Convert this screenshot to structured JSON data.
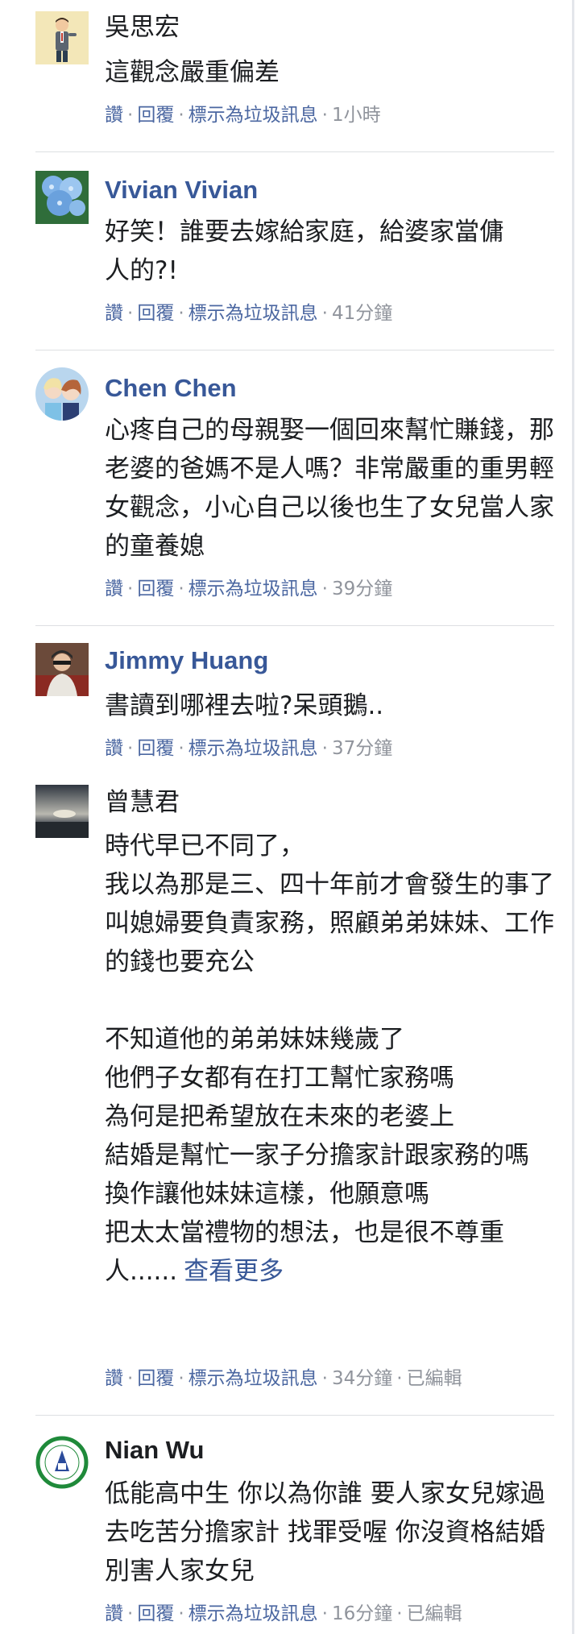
{
  "actions": {
    "like": "讚",
    "reply": "回覆",
    "mark_spam": "標示為垃圾訊息",
    "separator": "·"
  },
  "comments": [
    {
      "author": "吳思宏",
      "text": "這觀念嚴重偏差",
      "time": "1小時",
      "edited": ""
    },
    {
      "author": "Vivian Vivian",
      "text": "好笑！誰要去嫁給家庭，給婆家當傭人的?!",
      "time": "41分鐘",
      "edited": ""
    },
    {
      "author": "Chen Chen",
      "text": "心疼自己的母親娶一個回來幫忙賺錢，那老婆的爸媽不是人嗎？非常嚴重的重男輕女觀念，小心自己以後也生了女兒當人家的童養媳",
      "time": "39分鐘",
      "edited": ""
    },
    {
      "author": "Jimmy Huang",
      "text": "書讀到哪裡去啦?呆頭鵝..",
      "time": "37分鐘",
      "edited": ""
    },
    {
      "author": "曾慧君",
      "text": "時代早已不同了，\n我以為那是三、四十年前才會發生的事了\n叫媳婦要負責家務，照顧弟弟妹妹、工作的錢也要充公\n\n不知道他的弟弟妹妹幾歲了\n他們子女都有在打工幫忙家務嗎\n為何是把希望放在未來的老婆上\n結婚是幫忙一家子分擔家計跟家務的嗎\n換作讓他妹妹這樣，他願意嗎\n把太太當禮物的想法，也是很不尊重人......",
      "see_more": "查看更多",
      "time": "34分鐘",
      "edited": "已編輯"
    },
    {
      "author": "Nian Wu",
      "text": "低能高中生 你以為你誰 要人家女兒嫁過去吃苦分擔家計 找罪受喔 你沒資格結婚 別害人家女兒",
      "time": "16分鐘",
      "edited": "已編輯"
    }
  ]
}
